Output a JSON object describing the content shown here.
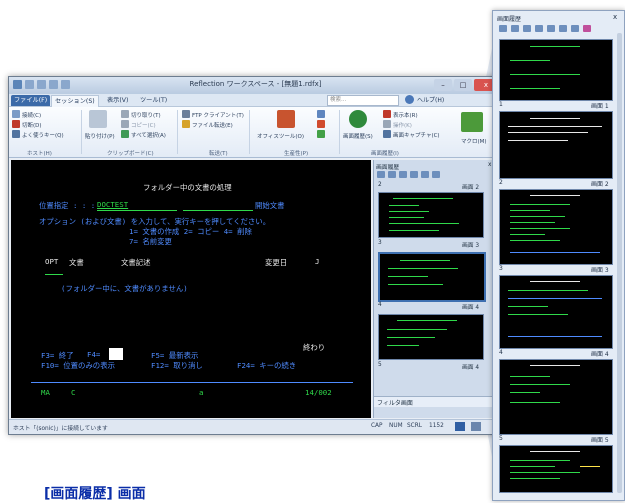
{
  "caption": "[画面履歴] 画面",
  "window": {
    "title": "Reflection ワークスペース - [無題1.rdfx]",
    "search_placeholder": "検索...",
    "help_label": "ヘルプ(H)",
    "controls": {
      "minimize": "–",
      "maximize": "□",
      "close": "x"
    }
  },
  "menu_tabs": [
    "ファイル(F)",
    "セッション(S)",
    "表示(V)",
    "ツール(T)"
  ],
  "ribbon": {
    "host_items": [
      "接続(C)",
      "切断(D)",
      "よく使うキー(Q)"
    ],
    "clipboard_left": "貼り付け(P)",
    "clipboard_items": [
      "切り取り(T)",
      "コピー(C)",
      "すべて選択(A)"
    ],
    "print_items": [
      "FTP クライアント(T)",
      "ファイル転送(E)"
    ],
    "office_label": "オフィスツール(O)",
    "history_label": "画面履歴(S)",
    "right_items": [
      "表示本(R)",
      "操作(K)",
      "画面キャプチャ(C)"
    ],
    "macro_label": "マクロ(M)",
    "group_labels": [
      "ホスト(H)",
      "クリップボード(C)",
      "転送(T)",
      "生産性(P)",
      "画面履歴(I)"
    ]
  },
  "terminal": {
    "header_date": "",
    "title": "フォルダー中の文書の処理",
    "location_label": "位置指定 : : :",
    "location_value": "DOCTEST",
    "start_doc": "開始文書",
    "instruction": "オプション (および文書) を入力して、実行キーを押してください。",
    "options_line1": "1= 文書の作成      2= コピー      4= 削除",
    "options_line2": "7= 名前変更",
    "col_opt": "OPT",
    "col_doc": "文書",
    "col_desc": "文書記述",
    "col_date": "変更日",
    "col_extra": "J",
    "empty_msg": "(フォルダー中に、文書がありません)",
    "end_label": "終わり",
    "fkeys_row1": [
      "F3= 終了",
      "F4= ",
      "F5= 最新表示"
    ],
    "fkeys_row2": [
      "F10= 位置のみの表示",
      "F12= 取り消し",
      "F24= キーの続き"
    ],
    "status_left": "MA",
    "status_c": "C",
    "status_a": "a",
    "status_pos": "14/002"
  },
  "statusbar": {
    "left": "ホスト「(sonic)」に接続しています",
    "right_items": [
      "CAP",
      "NUM",
      "SCRL",
      "1152"
    ]
  },
  "history_pane": {
    "title": "画面履歴",
    "close": "x",
    "thumbs": [
      {
        "num": "2",
        "label": "画面 2"
      },
      {
        "num": "3",
        "label": "画面 3"
      },
      {
        "num": "4",
        "label": "画面 4"
      }
    ],
    "bottom_label": "フィルタ画面"
  },
  "big_panel": {
    "title": "画面履歴",
    "close": "x",
    "thumbs": [
      {
        "num": "1",
        "label": "画面 1"
      },
      {
        "num": "2",
        "label": "画面 2"
      },
      {
        "num": "3",
        "label": "画面 3"
      },
      {
        "num": "4",
        "label": "画面 4"
      },
      {
        "num": "5",
        "label": "画面 5"
      }
    ]
  },
  "colors": {
    "terminal_bg": "#000000",
    "terminal_green": "#2fd94a",
    "terminal_blue": "#4f8bff",
    "terminal_yellow": "#ffe44a",
    "caption_blue": "#0b2ea8"
  }
}
